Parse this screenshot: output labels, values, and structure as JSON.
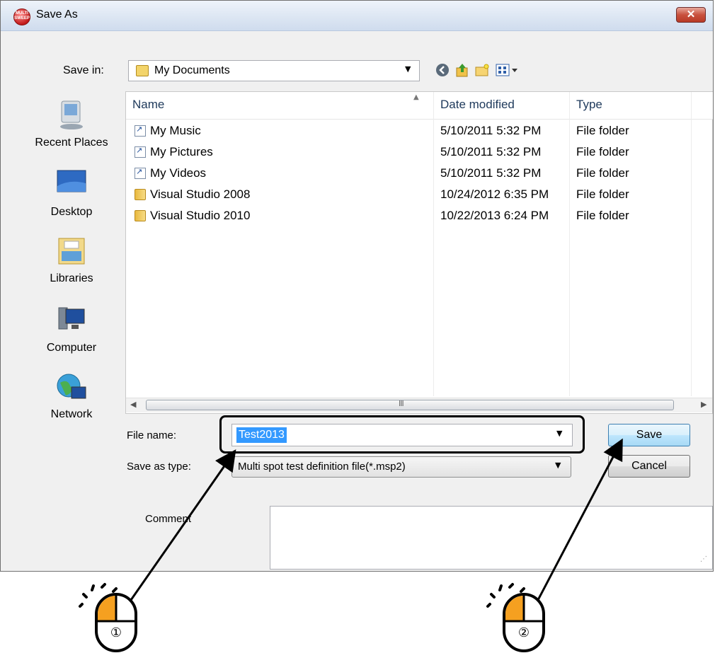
{
  "window": {
    "title": "Save As",
    "app_icon_text": "MULTI SWEEP",
    "close_glyph": "✕"
  },
  "toolbar": {
    "save_in_label": "Save in:",
    "save_in_value": "My Documents",
    "buttons": [
      "back-icon",
      "up-folder-icon",
      "new-folder-icon",
      "views-menu-icon"
    ]
  },
  "places": [
    {
      "label": "Recent Places",
      "icon": "recent-places-icon"
    },
    {
      "label": "Desktop",
      "icon": "desktop-icon"
    },
    {
      "label": "Libraries",
      "icon": "libraries-icon"
    },
    {
      "label": "Computer",
      "icon": "computer-icon"
    },
    {
      "label": "Network",
      "icon": "network-icon"
    }
  ],
  "filelist": {
    "columns": [
      "Name",
      "Date modified",
      "Type"
    ],
    "rows": [
      {
        "name": "My Music",
        "date": "5/10/2011 5:32 PM",
        "type": "File folder",
        "icon": "shortcut-icon"
      },
      {
        "name": "My Pictures",
        "date": "5/10/2011 5:32 PM",
        "type": "File folder",
        "icon": "shortcut-icon"
      },
      {
        "name": "My Videos",
        "date": "5/10/2011 5:32 PM",
        "type": "File folder",
        "icon": "shortcut-icon"
      },
      {
        "name": "Visual Studio 2008",
        "date": "10/24/2012 6:35 PM",
        "type": "File folder",
        "icon": "folder-icon"
      },
      {
        "name": "Visual Studio 2010",
        "date": "10/22/2013 6:24 PM",
        "type": "File folder",
        "icon": "folder-icon"
      }
    ],
    "scroll_grip": "III"
  },
  "form": {
    "file_name_label": "File name:",
    "file_name_value": "Test2013",
    "save_type_label": "Save as type:",
    "save_type_value": "Multi spot test definition file(*.msp2)",
    "save_label": "Save",
    "cancel_label": "Cancel",
    "comment_label": "Comment",
    "comment_value": ""
  },
  "annotations": {
    "step1": "①",
    "step2": "②",
    "mouse_highlight_color": "#f5a020"
  }
}
